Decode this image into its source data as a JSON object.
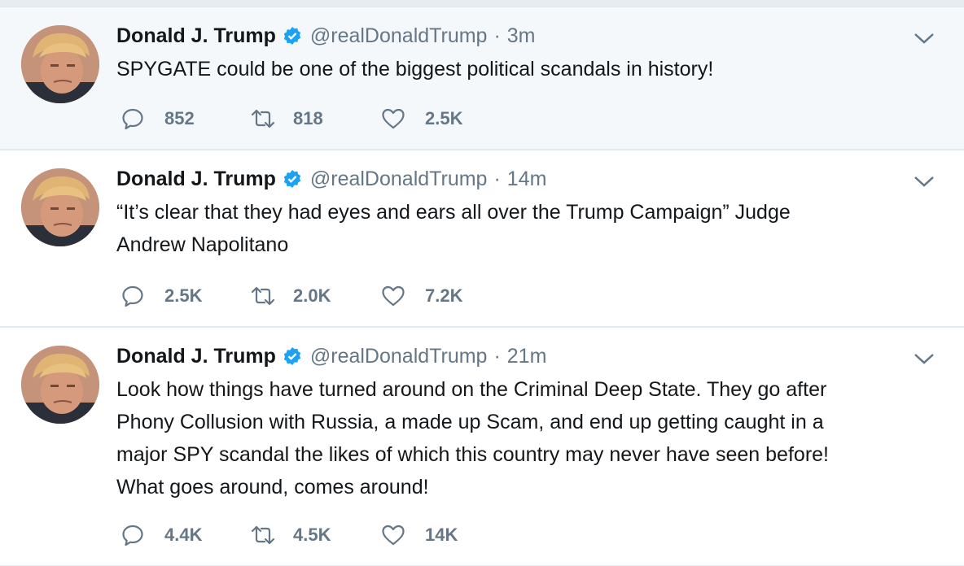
{
  "tweets": [
    {
      "name": "Donald J. Trump",
      "handle": "@realDonaldTrump",
      "separator": "·",
      "time": "3m",
      "lines": [
        "SPYGATE could be one of the biggest political scandals in history!"
      ],
      "replies": "852",
      "retweets": "818",
      "likes": "2.5K"
    },
    {
      "name": "Donald J. Trump",
      "handle": "@realDonaldTrump",
      "separator": "·",
      "time": "14m",
      "lines": [
        "“It’s clear that they had eyes and ears all over the Trump Campaign” Judge",
        "Andrew Napolitano"
      ],
      "replies": "2.5K",
      "retweets": "2.0K",
      "likes": "7.2K"
    },
    {
      "name": "Donald J. Trump",
      "handle": "@realDonaldTrump",
      "separator": "·",
      "time": "21m",
      "lines": [
        "Look how things have turned around on the Criminal Deep State. They go after",
        "Phony Collusion with Russia, a made up Scam, and end up getting caught in a",
        "major SPY scandal the likes of which this country may never have seen before!",
        "What goes around, comes around!"
      ],
      "replies": "4.4K",
      "retweets": "4.5K",
      "likes": "14K"
    }
  ],
  "icons": {
    "verified": "verified-badge-icon",
    "caret": "chevron-down-icon",
    "reply": "reply-icon",
    "retweet": "retweet-icon",
    "like": "heart-icon"
  },
  "colors": {
    "verified": "#1da1f2",
    "muted": "#657786",
    "text": "#14171a",
    "highlight_bg": "#f5f8fa"
  }
}
